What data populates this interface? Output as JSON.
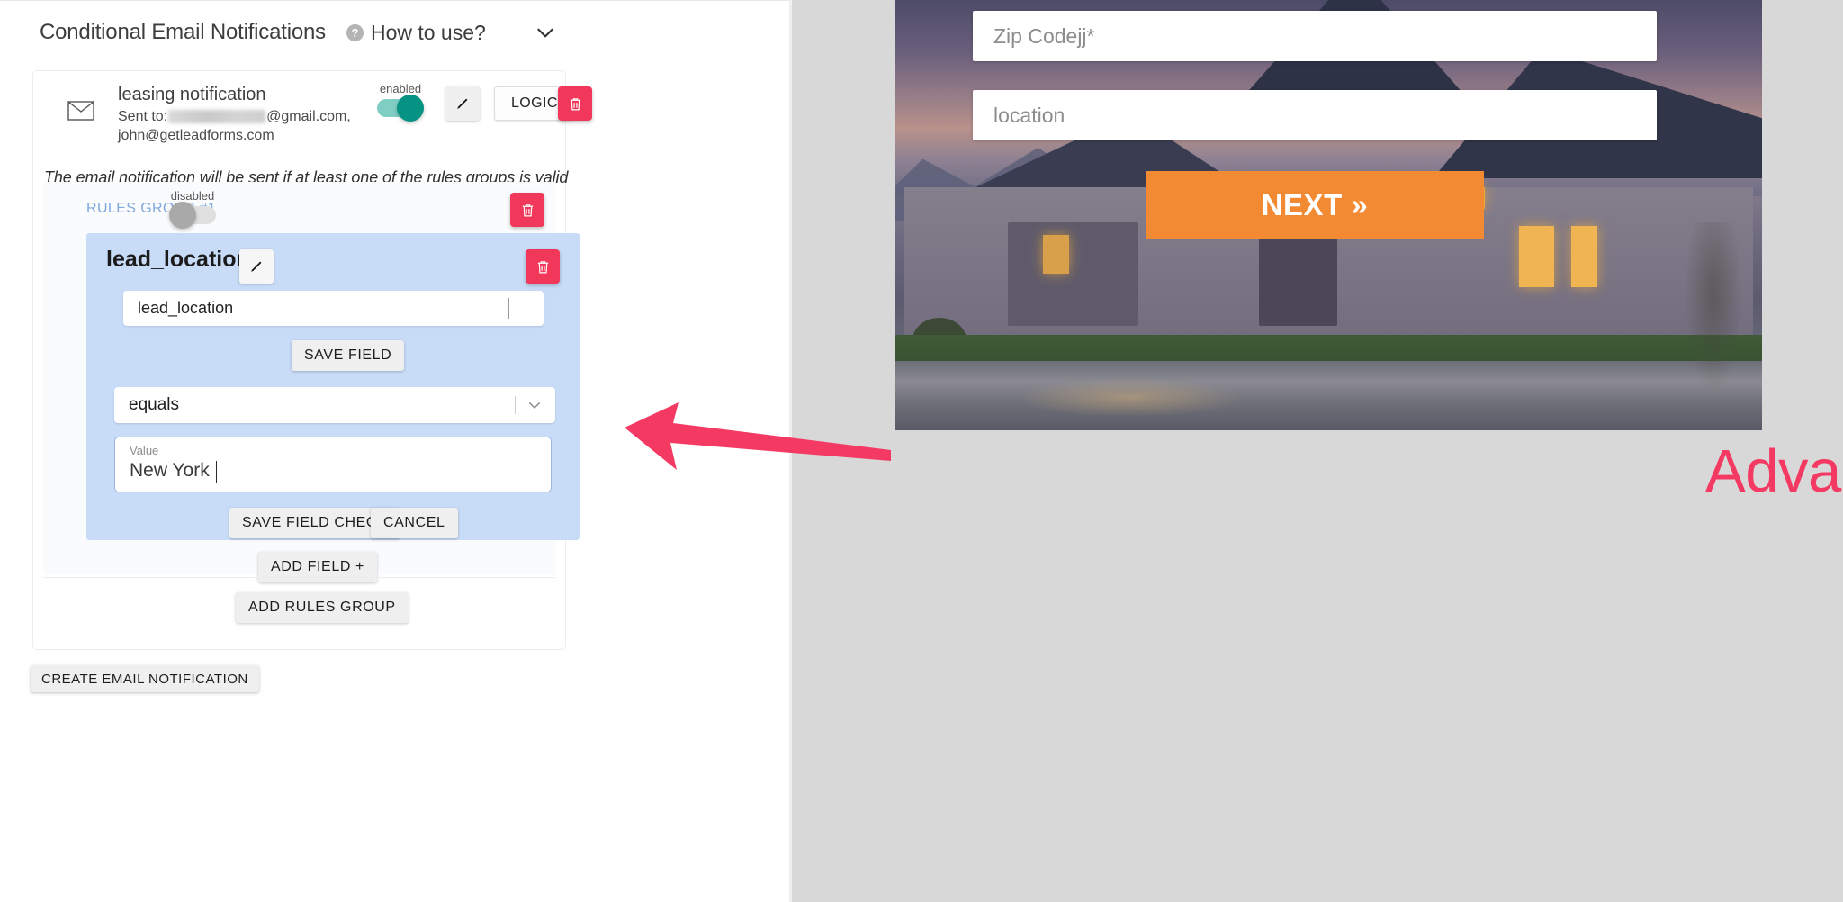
{
  "header": {
    "title": "Conditional Email Notifications",
    "help_icon": "question-mark-icon",
    "howto_label": "How to use?",
    "collapse_icon": "chevron-down-icon"
  },
  "notification": {
    "mail_icon": "envelope-icon",
    "name": "leasing notification",
    "sent_to_prefix": "Sent to:",
    "sent_to_suffix": "@gmail.com,",
    "sent_to_second": "john@getleadforms.com",
    "toggle_label": "enabled",
    "toggle_state": "on",
    "edit_icon": "pencil-icon",
    "logic_label": "LOGIC",
    "delete_icon": "trash-icon",
    "description": "The email notification will be sent if at least one of the rules groups is valid"
  },
  "rules_group": {
    "title": "RULES GROUP #1",
    "toggle_label": "disabled",
    "toggle_state": "off",
    "delete_icon": "trash-icon",
    "title_color": "#7fa8de",
    "field": {
      "name": "lead_location",
      "edit_icon": "pencil-icon",
      "delete_icon": "trash-icon",
      "field_input_value": "lead_location",
      "save_field_label": "SAVE FIELD",
      "operator_value": "equals",
      "operator_chevron": "chevron-down-icon",
      "value_label": "Value",
      "value_text": "New York",
      "save_field_check_label": "SAVE FIELD CHECK",
      "cancel_label": "CANCEL",
      "background_color": "#c8dcf8"
    },
    "add_field_label": "ADD FIELD +"
  },
  "add_rules_group_label": "ADD RULES GROUP",
  "create_email_notification_label": "CREATE EMAIL NOTIFICATION",
  "lead_form": {
    "zip_placeholder": "Zip Codejj*",
    "location_placeholder": "location",
    "zip_value": "",
    "location_value": "",
    "next_label": "NEXT »",
    "next_color": "#f28a33"
  },
  "annotation": {
    "caption": "Advanced lead routing logic",
    "caption_color": "#f43a63",
    "arrow_icon": "arrow-pointing-left-icon",
    "arrow_color": "#f43a63"
  }
}
